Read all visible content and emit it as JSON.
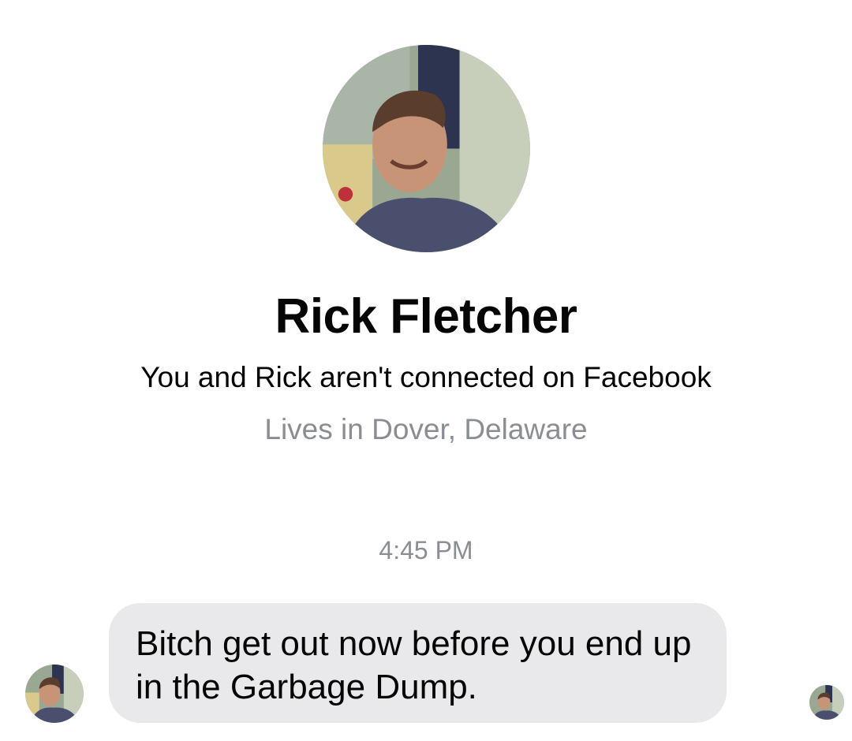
{
  "contact": {
    "name": "Rick Fletcher",
    "connection_status": "You and Rick aren't connected on Facebook",
    "location": "Lives in Dover, Delaware"
  },
  "conversation": {
    "timestamp": "4:45 PM",
    "messages": [
      {
        "sender": "Rick Fletcher",
        "text": "Bitch get out now before you end up in the Garbage Dump."
      }
    ]
  },
  "colors": {
    "background": "#ffffff",
    "bubble": "#e9e9eb",
    "secondary_text": "#8a8d91",
    "primary_text": "#050505"
  }
}
